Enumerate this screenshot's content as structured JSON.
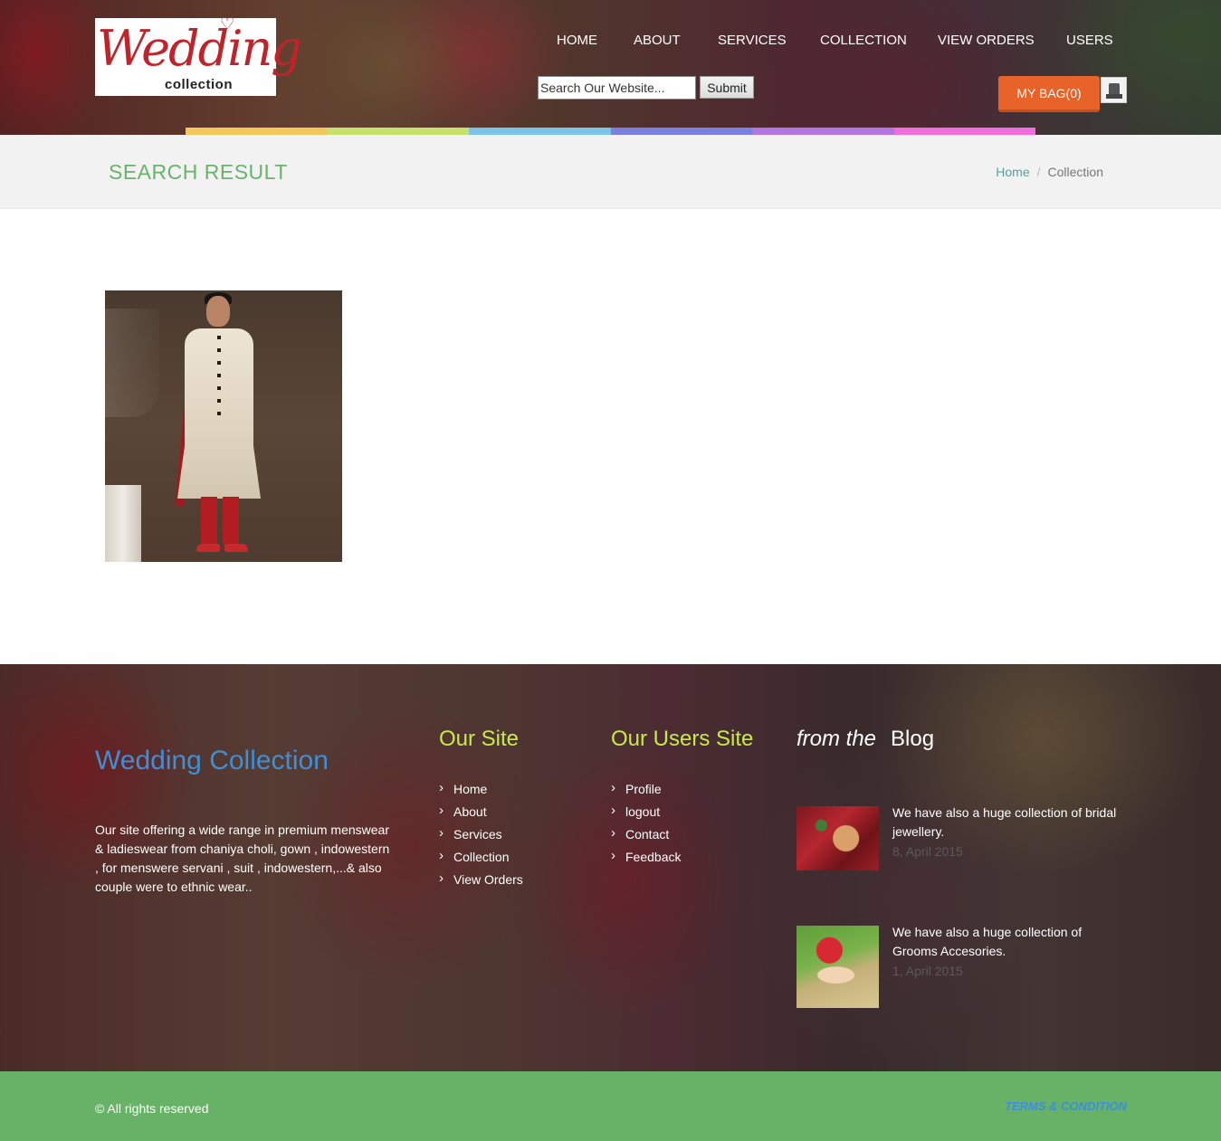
{
  "header": {
    "logo": {
      "script_text": "Wedding",
      "sub_text": "collection"
    },
    "nav": [
      {
        "label": "HOME"
      },
      {
        "label": "ABOUT"
      },
      {
        "label": "SERVICES"
      },
      {
        "label": "COLLECTION"
      },
      {
        "label": "VIEW ORDERS"
      },
      {
        "label": "USERS"
      }
    ],
    "search": {
      "value": "Search Our Website...",
      "submit_label": "Submit"
    },
    "bag_label": "MY BAG(0)",
    "color_bar": [
      "#f2c85b",
      "#c6e26c",
      "#7cc3e8",
      "#7b7fe2",
      "#b176e0",
      "#ef6ddc"
    ]
  },
  "title_strip": {
    "title": "SEARCH RESULT",
    "breadcrumb": {
      "home": "Home",
      "separator": "/",
      "current": "Collection"
    }
  },
  "results": [
    {
      "image": "groom-sherwani-product"
    }
  ],
  "footer": {
    "brand": "Wedding Collection",
    "about": "Our site offering a wide range in premium menswear & ladieswear from chaniya choli, gown , indowestern , for menswere servani , suit , indowestern,...& also couple were to ethnic wear..",
    "our_site": {
      "heading": "Our Site",
      "links": [
        "Home",
        "About",
        "Services",
        "Collection",
        "View Orders"
      ]
    },
    "users_site": {
      "heading": "Our Users Site",
      "links": [
        "Profile",
        "logout",
        "Contact",
        "Feedback"
      ]
    },
    "blog": {
      "heading_prefix": "from the",
      "heading": "Blog",
      "posts": [
        {
          "text": "We have also a huge collection of bridal jewellery.",
          "date": "8, April 2015"
        },
        {
          "text": "We have also a huge collection of Grooms Accesories.",
          "date": "1, April 2015"
        }
      ]
    }
  },
  "bottom_bar": {
    "copyright": "© All rights reserved",
    "terms": "TERMS & CONDITION"
  }
}
